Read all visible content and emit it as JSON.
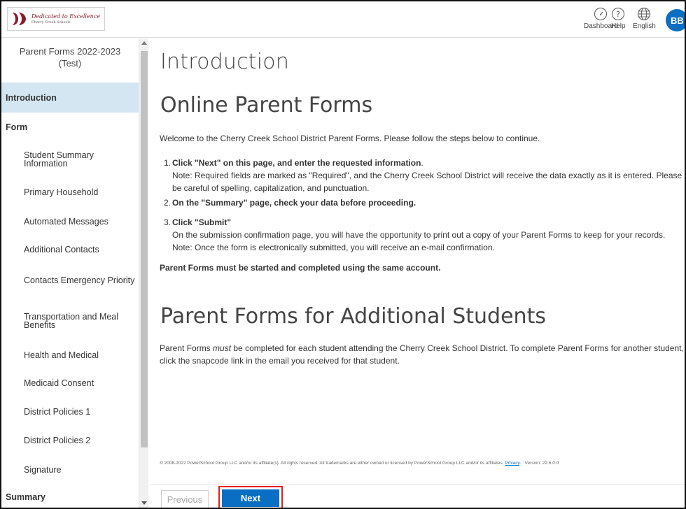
{
  "header": {
    "logo": {
      "line1": "Dedicated to Excellence",
      "line2": "Cherry Creek Schools"
    },
    "dashboard_label": "Dashboard",
    "help_label": "Help",
    "language_label": "English",
    "avatar_initials": "BB"
  },
  "sidebar": {
    "title": "Parent Forms 2022-2023 (Test)",
    "items": [
      {
        "label": "Introduction"
      },
      {
        "label": "Form"
      },
      {
        "label": "Student Summary Information"
      },
      {
        "label": "Primary Household"
      },
      {
        "label": "Automated Messages"
      },
      {
        "label": "Additional Contacts"
      },
      {
        "label": "Contacts Emergency Priority"
      },
      {
        "label": "Transportation and Meal Benefits"
      },
      {
        "label": "Health and Medical"
      },
      {
        "label": "Medicaid Consent"
      },
      {
        "label": "District Policies 1"
      },
      {
        "label": "District Policies 2"
      },
      {
        "label": "Signature"
      },
      {
        "label": "Summary"
      }
    ]
  },
  "main": {
    "page_title": "Introduction",
    "section1_title": "Online Parent Forms",
    "welcome": "Welcome to the Cherry Creek School District Parent Forms. Please follow the steps below to continue.",
    "steps": [
      {
        "num": "1.",
        "title": "Click \"Next\" on this page, and enter the requested information",
        "title_suffix": ".",
        "note": "Note: Required fields are marked as \"Required\", and the Cherry Creek School District will receive the data exactly as it is entered. Please be careful of spelling, capitalization, and punctuation."
      },
      {
        "num": "2.",
        "title": "On the \"Summary\" page, check your data before proceeding.",
        "title_suffix": "",
        "note": ""
      },
      {
        "num": "3.",
        "title": "Click \"Submit\"",
        "title_suffix": "",
        "note": "On the submission confirmation page, you will have the opportunity to print out a copy of your Parent Forms to keep for your records. Note: Once the form is electronically submitted, you will receive an e-mail confirmation."
      }
    ],
    "same_account": "Parent Forms must be started and completed using the same account.",
    "section2_title": "Parent Forms for Additional Students",
    "additional_pre": "Parent Forms ",
    "additional_em": "must",
    "additional_post": " be completed for each student attending the Cherry Creek School District. To complete Parent Forms for another student, click the snapcode link in the email you received for that student.",
    "footer_text": "© 2008-2022 PowerSchool Group LLC and/or its affiliate(s). All rights reserved. All trademarks are either owned or licensed by PowerSchool Group LLC and/or its affiliates.",
    "privacy_link": "Privacy",
    "version": "Version: 22.6.0.0"
  },
  "nav": {
    "previous_label": "Previous",
    "next_label": "Next"
  },
  "colors": {
    "accent": "#0a6fc2",
    "highlight": "#e32119",
    "active_nav": "#d4e6f1"
  }
}
